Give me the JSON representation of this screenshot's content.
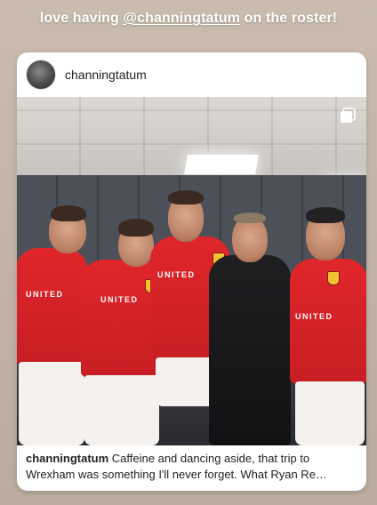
{
  "story": {
    "caption_prefix": "love having ",
    "caption_mention": "@channingtatum",
    "caption_suffix": " on the roster!"
  },
  "post": {
    "username": "channingtatum",
    "avatar_icon": "profile-avatar",
    "multi_icon": "carousel-icon",
    "caption_author": "channingtatum",
    "caption_text": "Caffeine and dancing aside, that trip to Wrexham was something I'll never forget. What Ryan Re…",
    "jersey_sponsor": "UNITED"
  }
}
